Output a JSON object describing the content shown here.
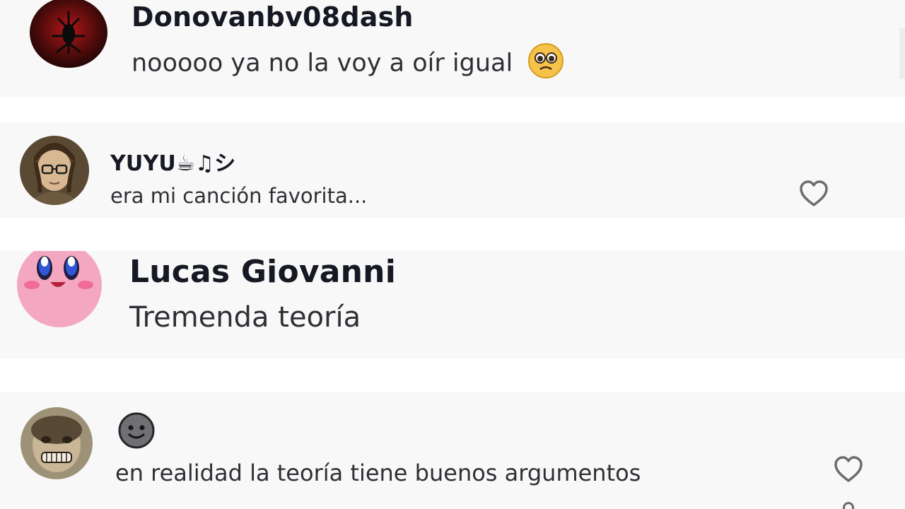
{
  "comments": [
    {
      "username": "Donovanbv08dash",
      "text": "nooooo ya no la voy a oír igual",
      "avatar_icon": "spider-emblem",
      "emoji_icon": "pleading-face-icon"
    },
    {
      "username": "YUYU☕♫シ",
      "text": "era mi canción favorita...",
      "avatar_icon": "anime-character",
      "like_icon": "heart-outline-icon"
    },
    {
      "username": "Lucas Giovanni",
      "text": "Tremenda teoría",
      "avatar_icon": "kirby"
    },
    {
      "username": "",
      "text": "en realidad la teoría tiene buenos argumentos",
      "avatar_icon": "monkey-face",
      "username_icon": "smiling-face-icon",
      "like_icon": "heart-outline-icon"
    }
  ],
  "colors": {
    "card_background": "#f8f8f8",
    "gap_background": "#ffffff",
    "username": "#161823",
    "text": "#2f2f35",
    "icon_stroke": "#6b6b70"
  }
}
